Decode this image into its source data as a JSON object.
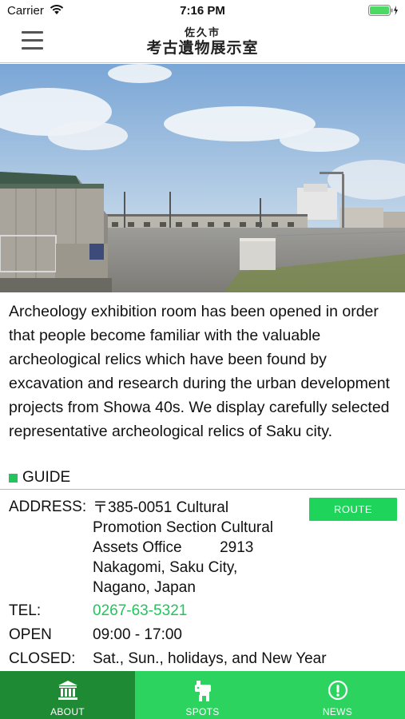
{
  "status_bar": {
    "carrier": "Carrier",
    "time": "7:16 PM"
  },
  "nav": {
    "title_sub": "佐久市",
    "title_main": "考古遺物展示室"
  },
  "description": "Archeology exhibition room has been opened in order that people become familiar with the valuable archeological relics which have been found by excavation and research during the urban development projects from Showa 40s. We display carefully selected representative archeological relics of Saku city.",
  "guide_label": "GUIDE",
  "info": {
    "address_label": "ADDRESS:",
    "address_lines": [
      "〒385-0051 Cultural",
      "Promotion Section Cultural",
      "Assets Office         2913",
      "Nakagomi, Saku City,",
      "Nagano, Japan"
    ],
    "tel_label": "TEL:",
    "tel_value": "0267-63-5321",
    "open_label": "OPEN",
    "open_value": "09:00 - 17:00",
    "closed_label": "CLOSED:",
    "closed_value": "Sat., Sun., holidays, and New Year"
  },
  "route_button": "ROUTE",
  "tabs": [
    {
      "label": "ABOUT",
      "icon": "museum-icon",
      "active": true
    },
    {
      "label": "SPOTS",
      "icon": "dogu-figure-icon",
      "active": false
    },
    {
      "label": "NEWS",
      "icon": "info-icon",
      "active": false
    }
  ],
  "colors": {
    "accent_green": "#2cd45f",
    "active_tab": "#1f8a34",
    "route_button": "#1fd45a"
  }
}
